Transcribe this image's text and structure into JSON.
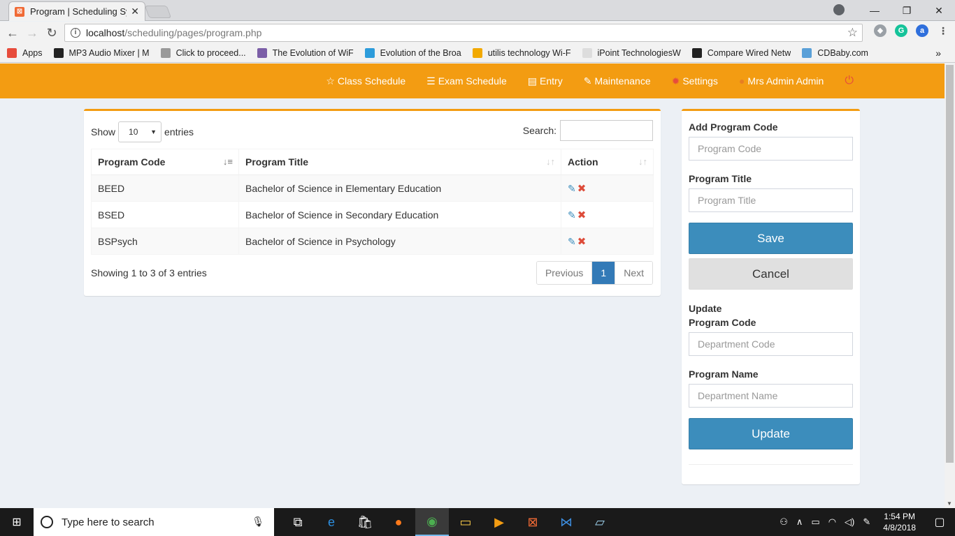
{
  "browser": {
    "tab_title": "Program | Scheduling Sys",
    "url_host": "localhost",
    "url_path": "/scheduling/pages/program.php",
    "bookmarks": [
      {
        "label": "Apps",
        "icon": "apps-grid-icon",
        "color": "#e74c3c"
      },
      {
        "label": "MP3 Audio Mixer | M",
        "icon": "mixer-icon",
        "color": "#222222"
      },
      {
        "label": "Click to proceed...",
        "icon": "page-icon",
        "color": "#999999"
      },
      {
        "label": "The Evolution of WiF",
        "icon": "wifi-icon",
        "color": "#7b5ea7"
      },
      {
        "label": "Evolution of the Broa",
        "icon": "globe-icon",
        "color": "#2d9cdb"
      },
      {
        "label": "utilis technology Wi-F",
        "icon": "u-icon",
        "color": "#f2a900"
      },
      {
        "label": "iPoint TechnologiesW",
        "icon": "ipoint-icon",
        "color": "#dddddd"
      },
      {
        "label": "Compare Wired Netw",
        "icon": "g-icon",
        "color": "#222222"
      },
      {
        "label": "CDBaby.com",
        "icon": "cdbaby-icon",
        "color": "#5aa0d8"
      }
    ]
  },
  "nav": {
    "class_schedule": "Class Schedule",
    "exam_schedule": "Exam Schedule",
    "entry": "Entry",
    "maintenance": "Maintenance",
    "settings": "Settings",
    "user": "Mrs Admin Admin"
  },
  "table": {
    "show_label": "Show",
    "entries_label": "entries",
    "length_value": "10",
    "search_label": "Search:",
    "headers": [
      "Program Code",
      "Program Title",
      "Action"
    ],
    "rows": [
      {
        "code": "BEED",
        "title": "Bachelor of Science in Elementary Education"
      },
      {
        "code": "BSED",
        "title": "Bachelor of Science in Secondary Education"
      },
      {
        "code": "BSPsych",
        "title": "Bachelor of Science in Psychology"
      }
    ],
    "info": "Showing 1 to 3 of 3 entries",
    "pager": {
      "prev": "Previous",
      "current": "1",
      "next": "Next"
    }
  },
  "form": {
    "add_title": "Add Program Code",
    "code_placeholder": "Program Code",
    "title_label": "Program Title",
    "title_placeholder": "Program Title",
    "save": "Save",
    "cancel": "Cancel",
    "update_title_1": "Update",
    "update_title_2": "Program Code",
    "dept_code_placeholder": "Department Code",
    "name_label": "Program Name",
    "dept_name_placeholder": "Department Name",
    "update": "Update"
  },
  "taskbar": {
    "search_placeholder": "Type here to search",
    "time": "1:54 PM",
    "date": "4/8/2018"
  },
  "colors": {
    "navbar": "#f39c12",
    "primary": "#3c8dbc",
    "danger": "#dd4b39"
  }
}
